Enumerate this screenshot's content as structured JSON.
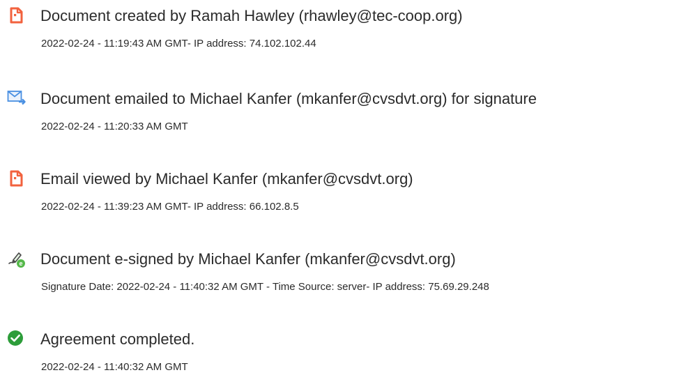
{
  "events": [
    {
      "icon": "document-created-icon",
      "title": "Document created by Ramah Hawley (rhawley@tec-coop.org)",
      "detail": "2022-02-24 - 11:19:43 AM GMT- IP address: 74.102.102.44"
    },
    {
      "icon": "document-emailed-icon",
      "title": "Document emailed to Michael Kanfer (mkanfer@cvsdvt.org) for signature",
      "detail": "2022-02-24 - 11:20:33 AM GMT"
    },
    {
      "icon": "email-viewed-icon",
      "title": "Email viewed by Michael Kanfer (mkanfer@cvsdvt.org)",
      "detail": "2022-02-24 - 11:39:23 AM GMT- IP address: 66.102.8.5"
    },
    {
      "icon": "e-sign-icon",
      "title": "Document e-signed by Michael Kanfer (mkanfer@cvsdvt.org)",
      "detail": "Signature Date: 2022-02-24 - 11:40:32 AM GMT - Time Source: server- IP address: 75.69.29.248"
    },
    {
      "icon": "check-circle-icon",
      "title": "Agreement completed.",
      "detail": "2022-02-24 - 11:40:32 AM GMT"
    }
  ],
  "colors": {
    "text": "#2b2b2b",
    "document_icon": "#f2623e",
    "email_icon": "#4a90e2",
    "sign_icon": "#55b84a",
    "check_icon": "#2d9d3a"
  }
}
